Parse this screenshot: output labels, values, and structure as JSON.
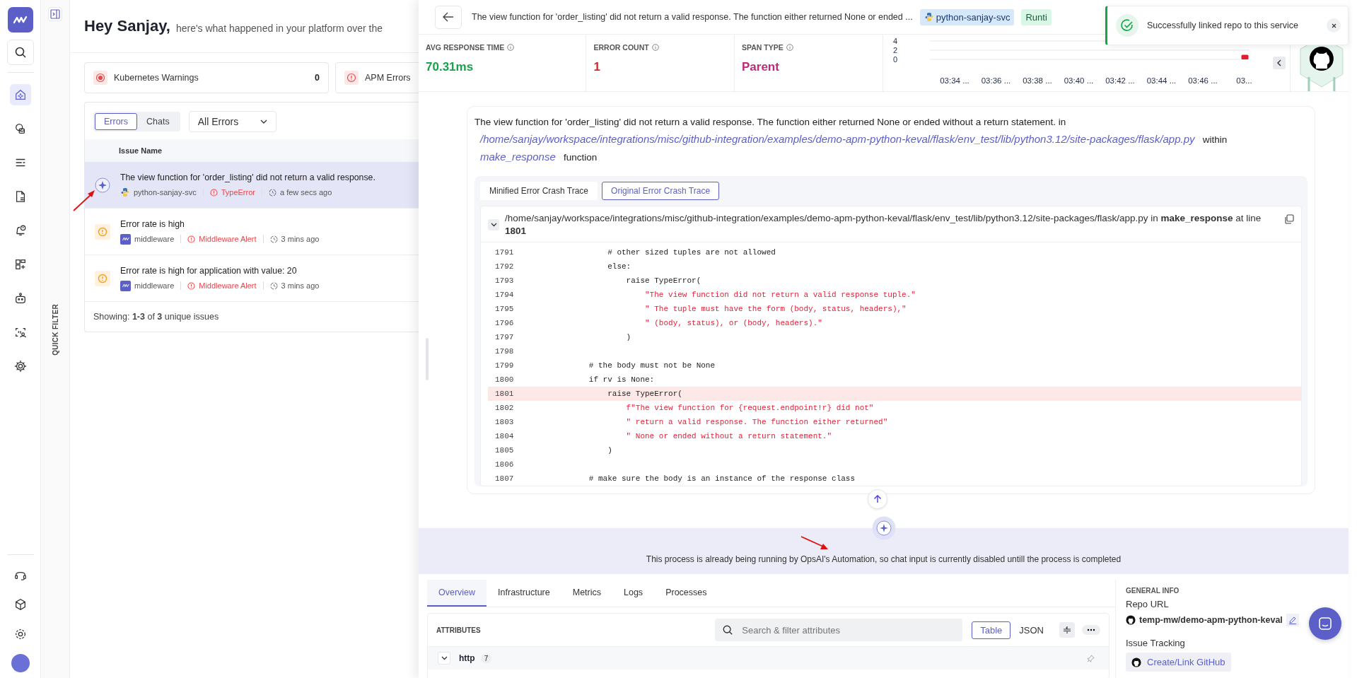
{
  "nav": [
    {
      "kind": "search",
      "selected": false
    },
    {
      "kind": "home",
      "selected": true
    },
    {
      "kind": "database",
      "selected": false
    },
    {
      "kind": "list",
      "selected": false
    },
    {
      "kind": "document",
      "selected": false
    },
    {
      "kind": "bell",
      "selected": false
    },
    {
      "kind": "dashboard",
      "selected": false
    },
    {
      "kind": "robot",
      "selected": false
    },
    {
      "kind": "user-scan",
      "selected": false
    },
    {
      "kind": "chip",
      "selected": false
    }
  ],
  "nav_bottom": [
    {
      "kind": "headset"
    },
    {
      "kind": "cube"
    },
    {
      "kind": "settings"
    },
    {
      "kind": "avatar"
    }
  ],
  "quick_filter": "QUICK FILTER",
  "greeting": {
    "title": "Hey Sanjay,",
    "subtitle": "here's what happened in your platform over the"
  },
  "summary_cards": [
    {
      "kind": "kubernetes",
      "label": "Kubernetes Warnings",
      "count": "0"
    },
    {
      "kind": "apm",
      "label": "APM Errors"
    }
  ],
  "issue_tabs": [
    {
      "label": "Errors",
      "selected": true
    },
    {
      "label": "Chats",
      "selected": false
    }
  ],
  "issue_filter": {
    "value": "All Errors"
  },
  "issue_table": {
    "column": "Issue Name",
    "rows": [
      {
        "kind": "ai",
        "selected": true,
        "title": "The view function for 'order_listing' did not return a valid response.",
        "service": {
          "kind": "python",
          "name": "python-sanjay-svc"
        },
        "error": "TypeError",
        "time": "a few secs ago"
      },
      {
        "kind": "alert",
        "selected": false,
        "title": "Error rate is high",
        "service": {
          "kind": "middleware",
          "name": "middleware"
        },
        "error": "Middleware Alert",
        "time": "3 mins ago"
      },
      {
        "kind": "alert",
        "selected": false,
        "title": "Error rate is high for application with value: 20",
        "service": {
          "kind": "middleware",
          "name": "middleware"
        },
        "error": "Middleware Alert",
        "time": "3 mins ago"
      }
    ],
    "footer": "Showing: **1-3** of **3** unique issues"
  },
  "drawer": {
    "title": "The view function for 'order_listing' did not return a valid response. The function either returned None or ended ...",
    "chips": [
      {
        "kind": "service",
        "label": "python-sanjay-svc"
      },
      {
        "kind": "runtime",
        "label": "Runti"
      }
    ],
    "metrics": [
      {
        "label": "AVG RESPONSE TIME",
        "value": "70.31ms",
        "color": "#16a34a"
      },
      {
        "label": "ERROR COUNT",
        "value": "1",
        "color": "#dc2626"
      },
      {
        "label": "SPAN TYPE",
        "value": "Parent",
        "color": "#c0297a"
      }
    ],
    "chart_data": {
      "type": "bar",
      "categories": [
        "03:34 ...",
        "03:36 ...",
        "03:38 ...",
        "03:40 ...",
        "03:42 ...",
        "03:44 ...",
        "03:46 ...",
        "03..."
      ],
      "values": [
        0,
        0,
        0,
        0,
        0,
        0,
        0,
        1
      ],
      "yticks": [
        0,
        2,
        4
      ],
      "ylim": [
        0,
        4
      ]
    },
    "message": {
      "text": "The view function for 'order_listing' did not return a valid response. The function either returned None or ended without a return statement. in",
      "file_link": "/home/sanjay/workspace/integrations/misc/github-integration/examples/demo-apm-python-keval/flask/env_test/lib/python3.12/site-packages/flask/app.py",
      "within": "within",
      "function_link": "make_response",
      "function_word": "function"
    },
    "trace_tabs": [
      {
        "label": "Minified Error Crash Trace",
        "selected": false
      },
      {
        "label": "Original Error Crash Trace",
        "selected": true
      }
    ],
    "trace_header": "/home/sanjay/workspace/integrations/misc/github-integration/examples/demo-apm-python-keval/flask/env_test/lib/python3.12/site-packages/flask/app.py in **make_response** at line **1801**",
    "code": [
      {
        "number": "1791",
        "kind": "code",
        "highlighted": false,
        "text": "            # other sized tuples are not allowed"
      },
      {
        "number": "1792",
        "kind": "code",
        "highlighted": false,
        "text": "            else:"
      },
      {
        "number": "1793",
        "kind": "code",
        "highlighted": false,
        "text": "                raise TypeError("
      },
      {
        "number": "1794",
        "kind": "string",
        "highlighted": false,
        "text": "                    \"The view function did not return a valid response tuple.\""
      },
      {
        "number": "1795",
        "kind": "string",
        "highlighted": false,
        "text": "                    \" The tuple must have the form (body, status, headers),\""
      },
      {
        "number": "1796",
        "kind": "string",
        "highlighted": false,
        "text": "                    \" (body, status), or (body, headers).\""
      },
      {
        "number": "1797",
        "kind": "code",
        "highlighted": false,
        "text": "                )"
      },
      {
        "number": "1798",
        "kind": "code",
        "highlighted": false
      },
      {
        "number": "1799",
        "kind": "code",
        "highlighted": false,
        "text": "        # the body must not be None"
      },
      {
        "number": "1800",
        "kind": "code",
        "highlighted": false,
        "text": "        if rv is None:"
      },
      {
        "number": "1801",
        "kind": "code",
        "highlighted": true,
        "text": "            raise TypeError("
      },
      {
        "number": "1802",
        "kind": "string",
        "highlighted": false,
        "text": "                f\"The view function for {request.endpoint!r} did not\""
      },
      {
        "number": "1803",
        "kind": "string",
        "highlighted": false,
        "text": "                \" return a valid response. The function either returned\""
      },
      {
        "number": "1804",
        "kind": "string",
        "highlighted": false,
        "text": "                \" None or ended without a return statement.\""
      },
      {
        "number": "1805",
        "kind": "code",
        "highlighted": false,
        "text": "            )"
      },
      {
        "number": "1806",
        "kind": "code",
        "highlighted": false
      },
      {
        "number": "1807",
        "kind": "code",
        "highlighted": false,
        "text": "        # make sure the body is an instance of the response class"
      }
    ],
    "banner": "This process is already being running by OpsAI's Automation, so chat input is currently disabled untill the process is completed",
    "tabs": [
      {
        "label": "Overview",
        "selected": true
      },
      {
        "label": "Infrastructure",
        "selected": false
      },
      {
        "label": "Metrics",
        "selected": false
      },
      {
        "label": "Logs",
        "selected": false
      },
      {
        "label": "Processes",
        "selected": false
      }
    ],
    "attributes": {
      "title": "ATTRIBUTES",
      "search": {
        "placeholder": "Search & filter attributes"
      },
      "views": [
        {
          "label": "Table",
          "selected": true
        },
        {
          "label": "JSON",
          "selected": false
        }
      ],
      "groups": [
        {
          "name": "http",
          "count": "7",
          "expanded": true
        }
      ]
    },
    "general_info": {
      "title": "GENERAL INFO",
      "repo_label": "Repo URL",
      "repo": "temp-mw/demo-apm-python-keval",
      "tracking_label": "Issue Tracking",
      "tracking_button": "Create/Link GitHub"
    }
  },
  "toast": {
    "message": "Successfully linked repo to this service"
  }
}
